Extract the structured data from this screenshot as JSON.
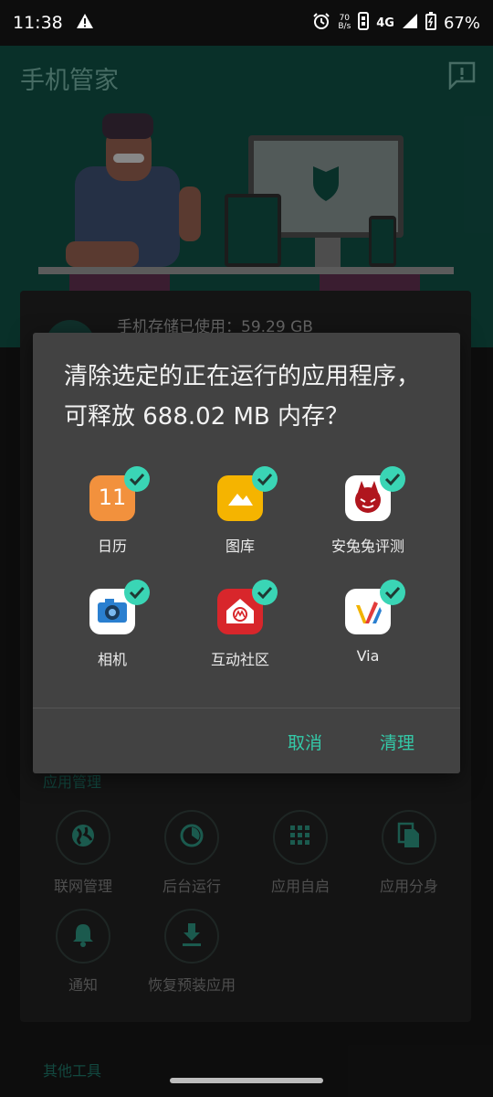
{
  "status_bar": {
    "time": "11:38",
    "net_speed_top": "70",
    "net_speed_unit": "B/s",
    "network": "4G",
    "battery": "67%"
  },
  "app": {
    "title": "手机管家",
    "storage_label": "手机存储已使用：59.29 GB"
  },
  "dialog": {
    "title": "清除选定的正在运行的应用程序，可释放 688.02 MB 内存？",
    "apps": [
      {
        "name": "日历",
        "icon": "calendar-icon",
        "color": "#f2913d",
        "checked": true,
        "glyph": "11"
      },
      {
        "name": "图库",
        "icon": "gallery-icon",
        "color": "#f5b400",
        "checked": true,
        "glyph": ""
      },
      {
        "name": "安兔兔评测",
        "icon": "antutu-icon",
        "color": "#ffffff",
        "checked": true,
        "glyph": ""
      },
      {
        "name": "相机",
        "icon": "camera-icon",
        "color": "#ffffff",
        "checked": true,
        "glyph": ""
      },
      {
        "name": "互动社区",
        "icon": "motorola-community-icon",
        "color": "#d8262b",
        "checked": true,
        "glyph": ""
      },
      {
        "name": "Via",
        "icon": "via-browser-icon",
        "color": "#ffffff",
        "checked": true,
        "glyph": ""
      }
    ],
    "cancel_label": "取消",
    "confirm_label": "清理"
  },
  "app_management": {
    "section_title": "应用管理",
    "tools": [
      {
        "label": "联网管理",
        "icon": "globe-icon"
      },
      {
        "label": "后台运行",
        "icon": "pie-icon"
      },
      {
        "label": "应用自启",
        "icon": "grid-icon"
      },
      {
        "label": "应用分身",
        "icon": "copy-icon"
      },
      {
        "label": "通知",
        "icon": "bell-icon"
      },
      {
        "label": "恢复预装应用",
        "icon": "download-icon"
      }
    ],
    "next_section_title": "其他工具"
  },
  "colors": {
    "accent": "#34c9a8",
    "header_bg": "#0f4a40",
    "dialog_bg": "#424242"
  }
}
